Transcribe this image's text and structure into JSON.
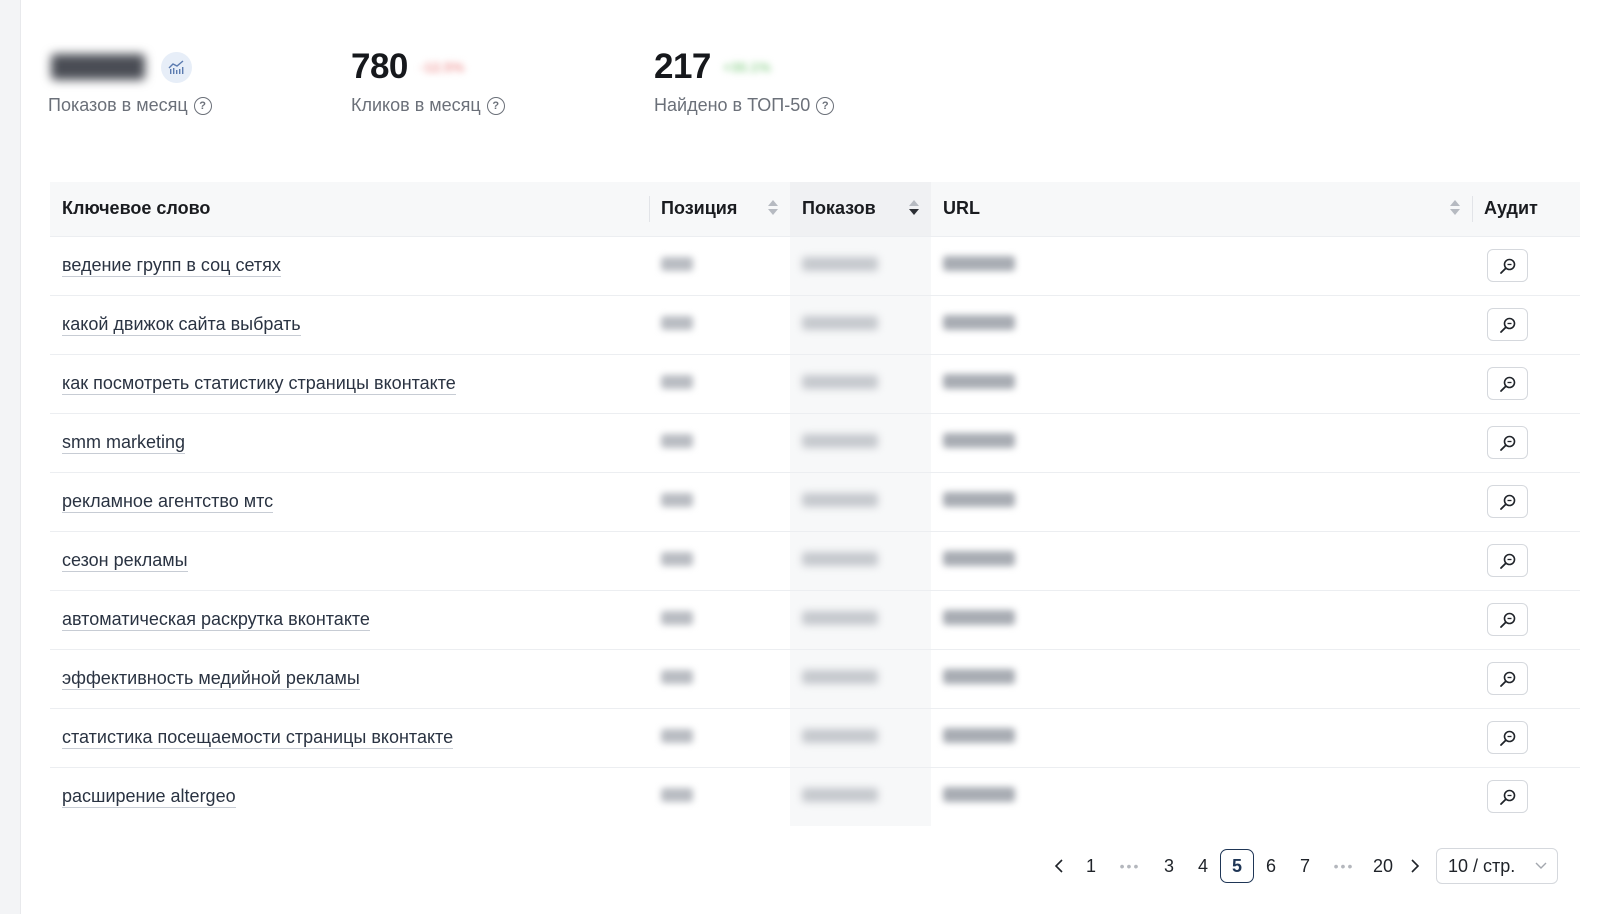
{
  "stats": [
    {
      "value": "",
      "label": "Показов в месяц",
      "delta": ""
    },
    {
      "value": "780",
      "label": "Кликов в месяц",
      "delta": "-12.5%",
      "delta_color": "#f0a0a0"
    },
    {
      "value": "217",
      "label": "Найдено в ТОП-50",
      "delta": "+30.1%",
      "delta_color": "#9ad69a"
    }
  ],
  "table": {
    "headers": {
      "keyword": "Ключевое слово",
      "position": "Позиция",
      "shows": "Показов",
      "url": "URL",
      "audit": "Аудит"
    },
    "rows": [
      {
        "keyword": "ведение групп в соц сетях"
      },
      {
        "keyword": "какой движок сайта выбрать"
      },
      {
        "keyword": "как посмотреть статистику страницы вконтакте"
      },
      {
        "keyword": "smm marketing"
      },
      {
        "keyword": "рекламное агентство мтс"
      },
      {
        "keyword": "сезон рекламы"
      },
      {
        "keyword": "автоматическая раскрутка вконтакте"
      },
      {
        "keyword": "эффективность медийной рекламы"
      },
      {
        "keyword": "статистика посещаемости страницы вконтакте"
      },
      {
        "keyword": "расширение altergeo"
      }
    ]
  },
  "pagination": {
    "prev": "<",
    "next": ">",
    "pages": [
      "1",
      "•••",
      "3",
      "4",
      "5",
      "6",
      "7",
      "•••",
      "20"
    ],
    "current": "5",
    "page_size": "10 / стр."
  },
  "icons": {
    "help": "question-circle-icon",
    "chart": "bar-chart-icon",
    "audit": "zoom-search-icon",
    "sort": "sort-arrows-icon",
    "dropdown": "chevron-down-icon"
  },
  "colors": {
    "accent": "#1f3656",
    "header_bg": "#f7f8f9",
    "chart_badge_bg": "#e7eef8"
  }
}
